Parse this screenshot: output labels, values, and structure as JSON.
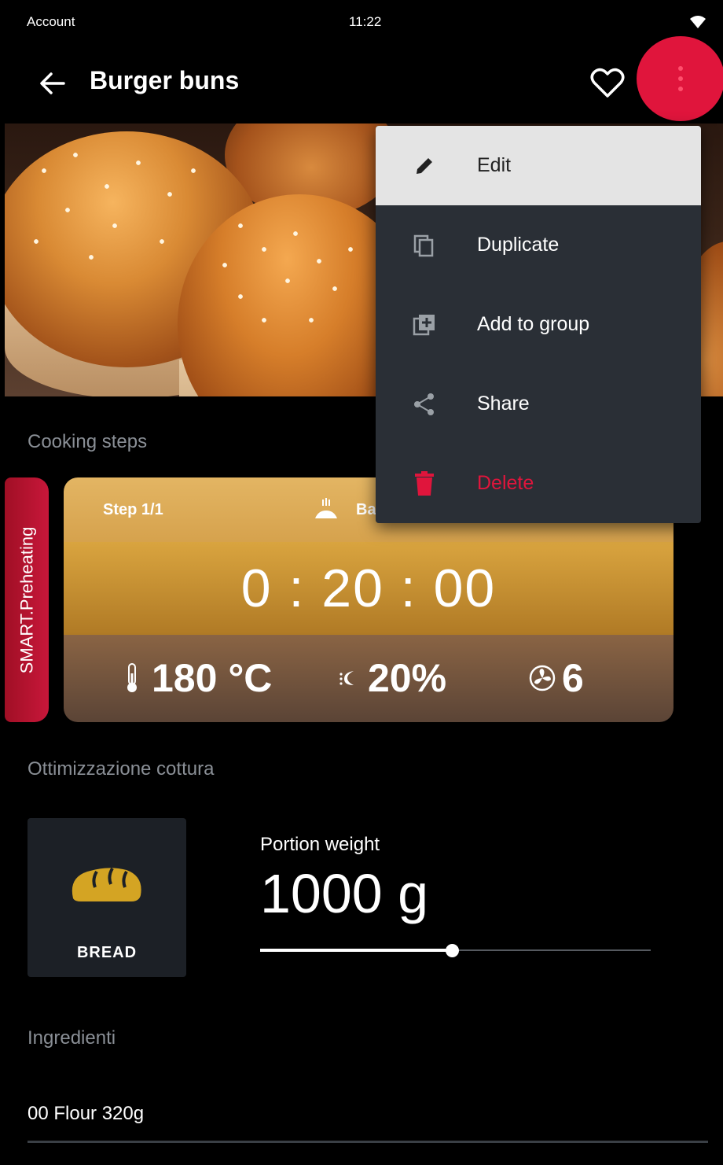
{
  "status_bar": {
    "left": "Account",
    "time": "11:22"
  },
  "app_bar": {
    "title": "Burger buns"
  },
  "menu": {
    "items": [
      {
        "label": "Edit",
        "icon": "pencil-icon"
      },
      {
        "label": "Duplicate",
        "icon": "copy-icon"
      },
      {
        "label": "Add to group",
        "icon": "add-to-group-icon"
      },
      {
        "label": "Share",
        "icon": "share-icon"
      },
      {
        "label": "Delete",
        "icon": "trash-icon"
      }
    ]
  },
  "sections": {
    "cooking_steps": "Cooking steps",
    "optimization": "Ottimizzazione cottura",
    "ingredients": "Ingredienti"
  },
  "smart_preheating": "SMART.Preheating",
  "step": {
    "label": "Step 1/1",
    "mode": "Ba",
    "time": "0 : 20 : 00",
    "temperature": "180 °C",
    "humidity": "20%",
    "fan": "6"
  },
  "optimization": {
    "category": "BREAD",
    "portion_label": "Portion weight",
    "portion_value": "1000 g",
    "slider_fraction": 0.49
  },
  "ingredients": [
    "00 Flour 320g"
  ],
  "colors": {
    "accent": "#e0153c",
    "menu_bg": "#2a2f36",
    "step_gold": "#d6a24d",
    "bread_icon": "#d4a423"
  }
}
